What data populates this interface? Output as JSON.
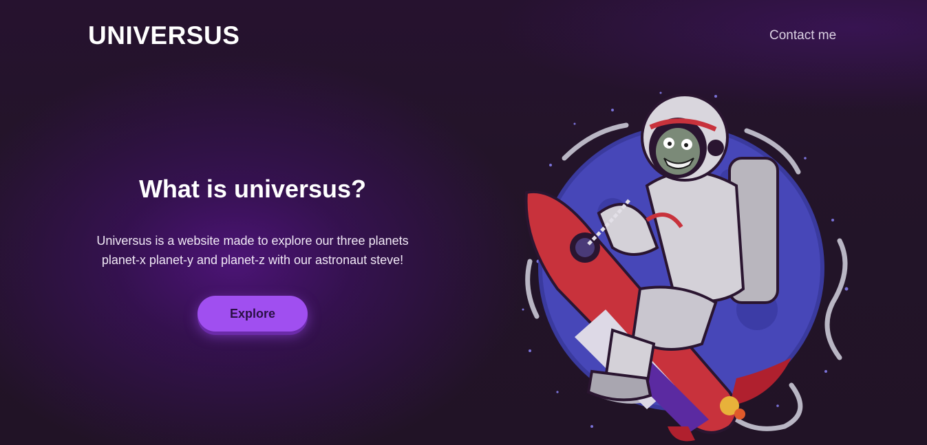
{
  "header": {
    "logo": "UNIVERSUS",
    "nav_link": "Contact me"
  },
  "hero": {
    "title": "What is universus?",
    "description": "Universus is a website made to explore our three planets planet-x planet-y and planet-z with our astronaut steve!",
    "button_label": "Explore"
  },
  "colors": {
    "background": "#231429",
    "accent": "#a04ff0",
    "planet": "#4747b8",
    "rocket_red": "#c8323c"
  },
  "illustration": {
    "icon": "astronaut-on-rocket-illustration"
  }
}
